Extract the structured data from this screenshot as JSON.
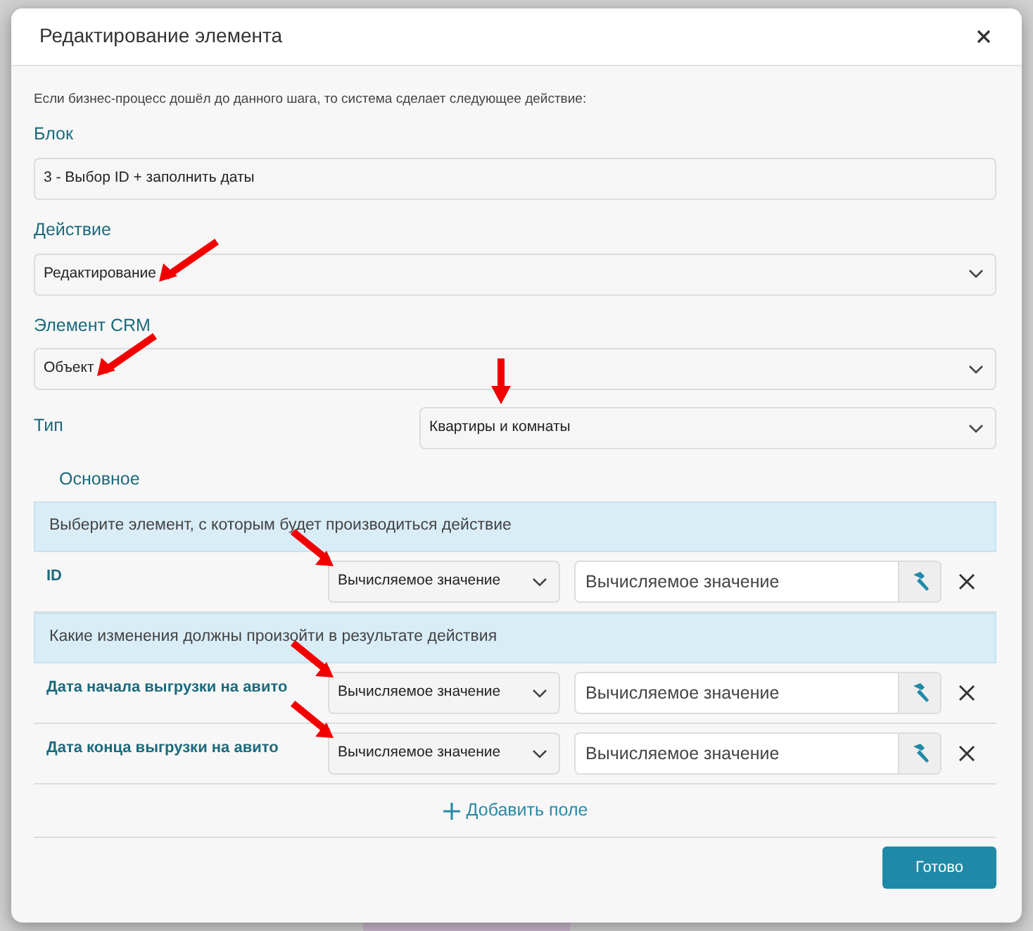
{
  "dialog": {
    "title": "Редактирование элемента",
    "intro": "Если бизнес-процесс дошёл до данного шага, то система сделает следующее действие:",
    "fields": [
      {
        "kind": "text",
        "label": "Блок",
        "value": "3 - Выбор ID + заполнить даты"
      },
      {
        "kind": "select",
        "label": "Действие",
        "value": "Редактирование",
        "annotated": true
      },
      {
        "kind": "select",
        "label": "Элемент CRM",
        "value": "Объект",
        "annotated": true
      },
      {
        "kind": "inline-select",
        "label": "Тип",
        "value": "Квартиры и комнаты",
        "annotated": true
      }
    ],
    "section_title": "Основное",
    "groups": [
      {
        "heading": "Выберите элемент, с которым будет производиться действие",
        "rows": [
          {
            "label": "ID",
            "mode": "Вычисляемое значение",
            "placeholder": "Вычисляемое значение",
            "annotated": true
          }
        ]
      },
      {
        "heading": "Какие изменения должны произойти в результате действия",
        "rows": [
          {
            "label": "Дата начала выгрузки на авито",
            "mode": "Вычисляемое значение",
            "placeholder": "Вычисляемое значение",
            "annotated": true
          },
          {
            "label": "Дата конца выгрузки на авито",
            "mode": "Вычисляемое значение",
            "placeholder": "Вычисляемое значение",
            "annotated": true
          }
        ]
      }
    ],
    "add_field": "Добавить поле",
    "done_button": "Готово"
  }
}
